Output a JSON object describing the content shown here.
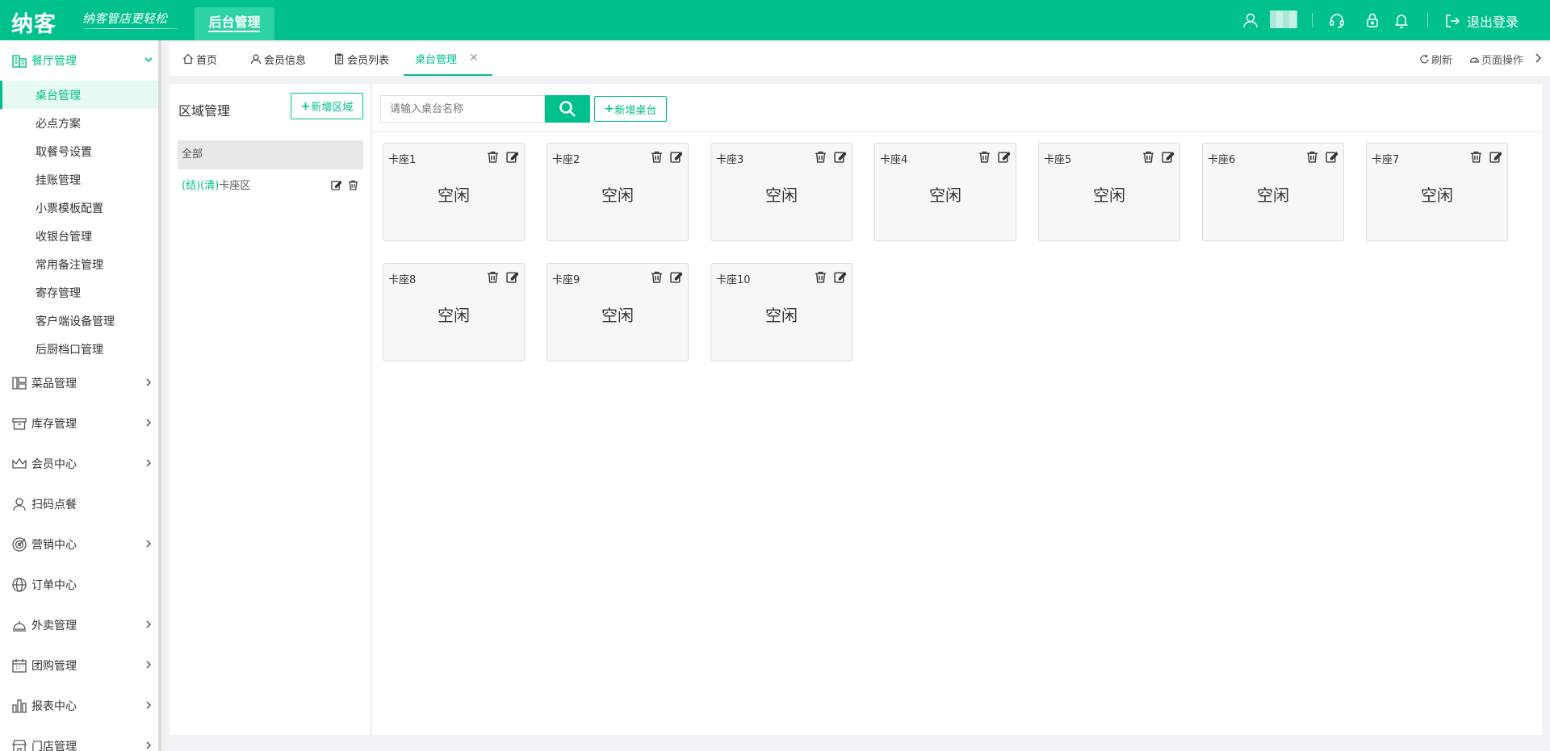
{
  "header": {
    "logo": "纳客",
    "slogan": "纳客管店更轻松",
    "active_tab": "后台管理",
    "logout_label": "退出登录"
  },
  "colors": {
    "brand": "#00c08b",
    "brand_light": "#e6f9f2"
  },
  "sidebar": {
    "open_group": {
      "label": "餐厅管理",
      "icon": "restaurant-icon"
    },
    "sub_items": [
      {
        "label": "桌台管理",
        "active": true
      },
      {
        "label": "必点方案"
      },
      {
        "label": "取餐号设置"
      },
      {
        "label": "挂账管理"
      },
      {
        "label": "小票模板配置"
      },
      {
        "label": "收银台管理"
      },
      {
        "label": "常用备注管理"
      },
      {
        "label": "寄存管理"
      },
      {
        "label": "客户端设备管理"
      },
      {
        "label": "后厨档口管理"
      }
    ],
    "groups": [
      {
        "label": "菜品管理",
        "icon": "layout-icon",
        "has_arrow": true
      },
      {
        "label": "库存管理",
        "icon": "box-icon",
        "has_arrow": true
      },
      {
        "label": "会员中心",
        "icon": "crown-icon",
        "has_arrow": true
      },
      {
        "label": "扫码点餐",
        "icon": "user-icon",
        "has_arrow": false
      },
      {
        "label": "营销中心",
        "icon": "target-icon",
        "has_arrow": true
      },
      {
        "label": "订单中心",
        "icon": "globe-icon",
        "has_arrow": false
      },
      {
        "label": "外卖管理",
        "icon": "bell-tray-icon",
        "has_arrow": true
      },
      {
        "label": "团购管理",
        "icon": "calendar-icon",
        "has_arrow": true
      },
      {
        "label": "报表中心",
        "icon": "bar-chart-icon",
        "has_arrow": true
      },
      {
        "label": "门店管理",
        "icon": "store-icon",
        "has_arrow": true
      }
    ]
  },
  "tabs": [
    {
      "label": "首页",
      "icon": "home-icon"
    },
    {
      "label": "会员信息",
      "icon": "user-icon"
    },
    {
      "label": "会员列表",
      "icon": "clipboard-icon"
    },
    {
      "label": "桌台管理",
      "active": true,
      "closable": true
    }
  ],
  "tab_close": "✕",
  "tab_actions": {
    "refresh": "刷新",
    "page_ops": "页面操作"
  },
  "area": {
    "title": "区域管理",
    "add_label": "新增区域",
    "all_label": "全部",
    "items": [
      {
        "tags": "(结)(清)",
        "name": "卡座区"
      }
    ]
  },
  "main": {
    "search_placeholder": "请输入桌台名称",
    "add_table_label": "新增桌台",
    "tables": [
      {
        "name": "卡座1",
        "status": "空闲"
      },
      {
        "name": "卡座2",
        "status": "空闲"
      },
      {
        "name": "卡座3",
        "status": "空闲"
      },
      {
        "name": "卡座4",
        "status": "空闲"
      },
      {
        "name": "卡座5",
        "status": "空闲"
      },
      {
        "name": "卡座6",
        "status": "空闲"
      },
      {
        "name": "卡座7",
        "status": "空闲"
      },
      {
        "name": "卡座8",
        "status": "空闲"
      },
      {
        "name": "卡座9",
        "status": "空闲"
      },
      {
        "name": "卡座10",
        "status": "空闲"
      }
    ]
  }
}
